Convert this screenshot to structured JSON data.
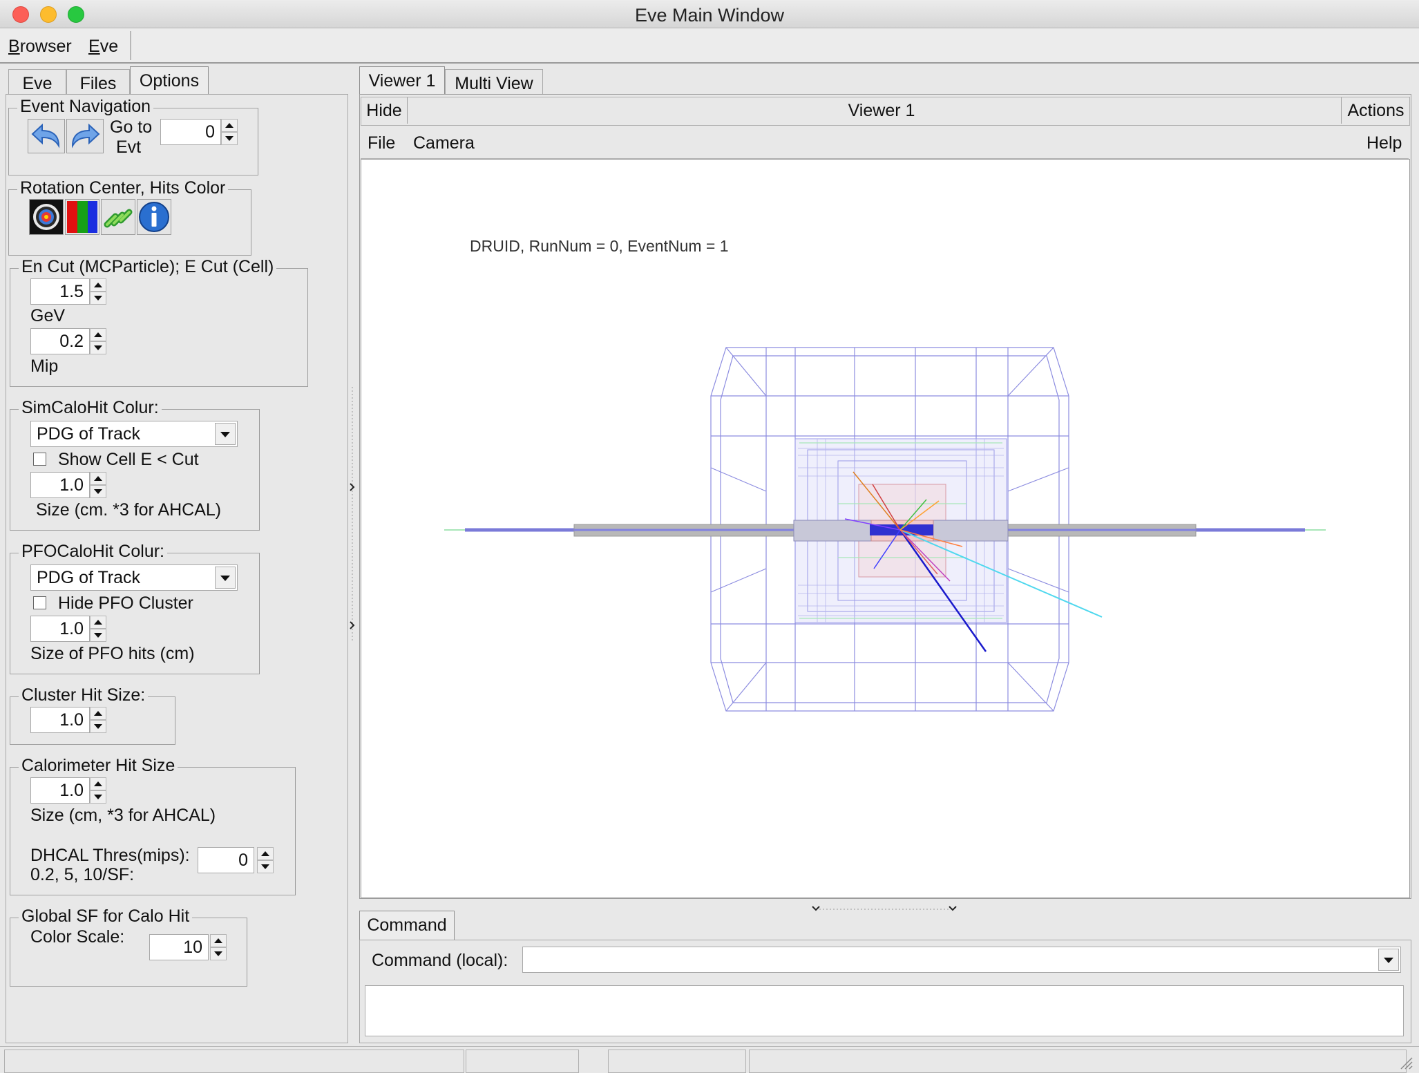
{
  "window": {
    "title": "Eve Main Window"
  },
  "menubar": {
    "browser_first": "B",
    "browser_rest": "rowser",
    "eve_first": "E",
    "eve_rest": "ve"
  },
  "left_tabs": [
    "Eve",
    "Files",
    "Options"
  ],
  "options": {
    "event_nav": {
      "title": "Event Navigation",
      "goto_line1": "Go to",
      "goto_line2": "Evt",
      "event_value": "0"
    },
    "rotation": {
      "title": "Rotation Center, Hits Color"
    },
    "en_cut": {
      "title": "En Cut (MCParticle); E Cut (Cell)",
      "en_value": "1.5",
      "en_unit": "GeV",
      "e_value": "0.2",
      "e_unit": "Mip"
    },
    "sim_calo": {
      "title": "SimCaloHit Colur:",
      "color_mode": "PDG of Track",
      "show_cell_label": "Show Cell E < Cut",
      "size_value": "1.0",
      "size_label": "Size (cm. *3 for AHCAL)"
    },
    "pfo_calo": {
      "title": "PFOCaloHit Colur:",
      "color_mode": "PDG of Track",
      "hide_cluster_label": "Hide PFO Cluster",
      "size_value": "1.0",
      "size_label": "Size of PFO hits (cm)"
    },
    "cluster_hit": {
      "title": "Cluster Hit Size:",
      "size_value": "1.0"
    },
    "calo_hit": {
      "title": "Calorimeter Hit Size",
      "size_value": "1.0",
      "size_label": "Size (cm, *3 for AHCAL)",
      "dhcal_label1": "DHCAL Thres(mips):",
      "dhcal_label2": "0.2, 5, 10/SF:",
      "dhcal_value": "0"
    },
    "global_sf": {
      "title": "Global SF for Calo Hit",
      "label": "Color Scale:",
      "value": "10"
    }
  },
  "right_tabs": [
    "Viewer 1",
    "Multi View"
  ],
  "viewer": {
    "hide_label": "Hide",
    "title": "Viewer 1",
    "actions_label": "Actions",
    "menu_file": "File",
    "menu_camera": "Camera",
    "menu_help": "Help",
    "event_info": "DRUID, RunNum = 0, EventNum = 1"
  },
  "command": {
    "tab_label": "Command",
    "label": "Command (local):",
    "value": ""
  },
  "colors": {
    "track_blue": "#1a1acc",
    "track_cyan": "#4fd8ee",
    "detector_wire": "#8c8ce0",
    "beam_pipe": "#b8b8b8"
  }
}
